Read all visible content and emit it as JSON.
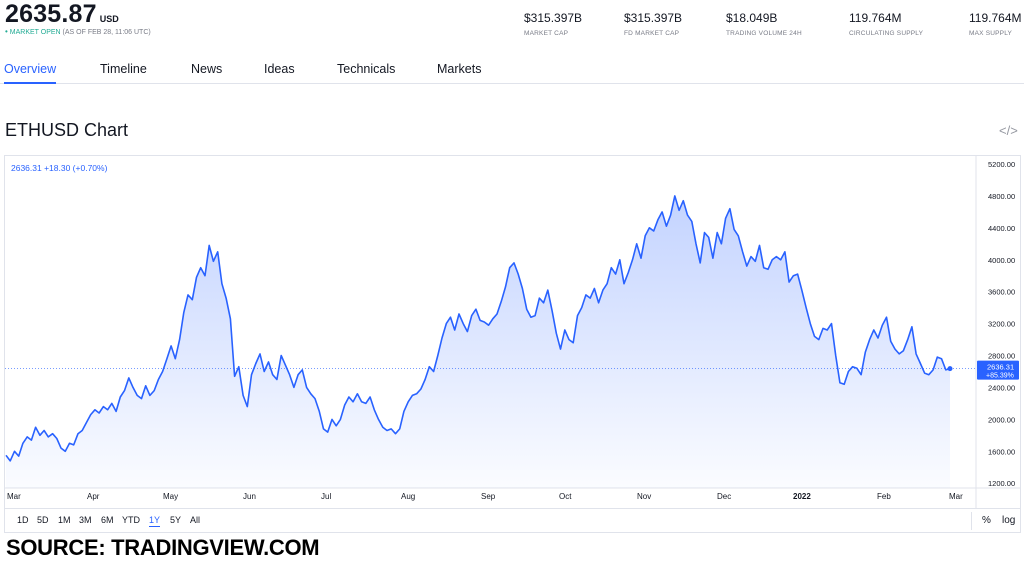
{
  "header": {
    "price": "2635.87",
    "currency": "USD",
    "status_dot": "•",
    "market_status": "MARKET OPEN",
    "status_detail": "(AS OF FEB 28, 11:06 UTC)",
    "stats": [
      {
        "value": "$315.397B",
        "label": "MARKET CAP"
      },
      {
        "value": "$315.397B",
        "label": "FD MARKET CAP"
      },
      {
        "value": "$18.049B",
        "label": "TRADING VOLUME 24H"
      },
      {
        "value": "119.764M",
        "label": "CIRCULATING SUPPLY"
      },
      {
        "value": "119.764M",
        "label": "MAX SUPPLY"
      }
    ]
  },
  "tabs": [
    "Overview",
    "Timeline",
    "News",
    "Ideas",
    "Technicals",
    "Markets"
  ],
  "active_tab": "Overview",
  "chart_title": "ETHUSD Chart",
  "embed_icon_glyph": "</>",
  "legend": "2636.31  +18.30 (+0.70%)",
  "price_tag": {
    "value": "2636.31",
    "change": "+85.39%"
  },
  "ranges": [
    "1D",
    "5D",
    "1M",
    "3M",
    "6M",
    "YTD",
    "1Y",
    "5Y",
    "All"
  ],
  "active_range": "1Y",
  "tools": {
    "percent": "%",
    "log": "log"
  },
  "source": "SOURCE: TRADINGVIEW.COM",
  "colors": {
    "line": "#2962ff",
    "fill": "#2962ff",
    "accent": "#2962ff",
    "status": "#22ab94"
  },
  "chart_data": {
    "type": "area",
    "x_ticks": [
      "Mar",
      "Apr",
      "May",
      "Jun",
      "Jul",
      "Aug",
      "Sep",
      "Oct",
      "Nov",
      "Dec",
      "2022",
      "Feb",
      "Mar"
    ],
    "y_ticks": [
      1200,
      1600,
      2000,
      2400,
      2800,
      3200,
      3600,
      4000,
      4400,
      4800,
      5200
    ],
    "ylim": [
      1140,
      5300
    ],
    "last_value": 2636.31,
    "series": [
      {
        "values": [
          1550,
          1480,
          1600,
          1540,
          1700,
          1780,
          1740,
          1900,
          1800,
          1860,
          1780,
          1820,
          1760,
          1640,
          1600,
          1700,
          1680,
          1820,
          1860,
          1960,
          2060,
          2120,
          2080,
          2160,
          2120,
          2200,
          2100,
          2280,
          2360,
          2520,
          2400,
          2300,
          2260,
          2420,
          2300,
          2360,
          2500,
          2600,
          2760,
          2920,
          2760,
          3000,
          3340,
          3560,
          3500,
          3780,
          3900,
          3800,
          4180,
          3980,
          4100,
          3700,
          3520,
          3260,
          2540,
          2660,
          2300,
          2160,
          2560,
          2700,
          2820,
          2600,
          2720,
          2560,
          2500,
          2800,
          2680,
          2560,
          2400,
          2560,
          2620,
          2400,
          2320,
          2260,
          2100,
          1880,
          1840,
          2000,
          1920,
          2000,
          2180,
          2280,
          2220,
          2320,
          2220,
          2200,
          2280,
          2120,
          2000,
          1900,
          1860,
          1880,
          1820,
          1880,
          2100,
          2220,
          2300,
          2320,
          2380,
          2500,
          2660,
          2600,
          2800,
          3020,
          3200,
          3280,
          3120,
          3320,
          3200,
          3100,
          3300,
          3380,
          3240,
          3220,
          3180,
          3260,
          3320,
          3480,
          3660,
          3900,
          3960,
          3820,
          3640,
          3380,
          3280,
          3300,
          3520,
          3460,
          3620,
          3360,
          3080,
          2880,
          3120,
          3000,
          2960,
          3300,
          3400,
          3560,
          3520,
          3640,
          3460,
          3620,
          3700,
          3900,
          3820,
          4000,
          3700,
          3840,
          4000,
          4200,
          4020,
          4300,
          4400,
          4360,
          4500,
          4600,
          4420,
          4560,
          4800,
          4620,
          4740,
          4560,
          4480,
          4200,
          3960,
          4340,
          4280,
          4020,
          4340,
          4200,
          4520,
          4640,
          4380,
          4300,
          4100,
          3920,
          4040,
          3980,
          4180,
          3900,
          3880,
          4000,
          4040,
          4000,
          4100,
          3720,
          3800,
          3820,
          3620,
          3400,
          3200,
          3040,
          3000,
          3140,
          3120,
          3200,
          2800,
          2460,
          2440,
          2600,
          2660,
          2640,
          2560,
          2840,
          3000,
          3120,
          3020,
          3180,
          3280,
          2980,
          2880,
          2820,
          2860,
          3000,
          3160,
          2820,
          2700,
          2580,
          2560,
          2620,
          2780,
          2760,
          2620,
          2636
        ]
      }
    ]
  }
}
